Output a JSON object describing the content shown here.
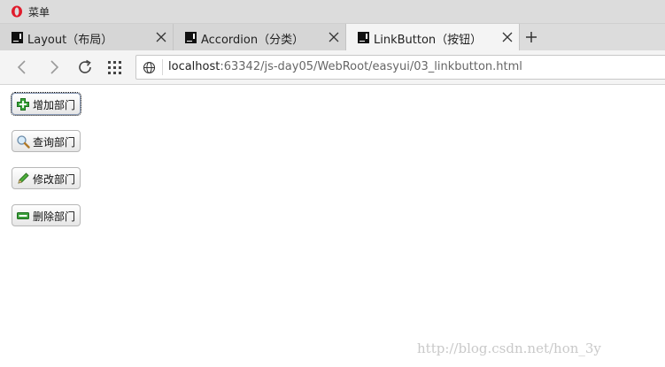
{
  "window": {
    "menu_label": "菜单"
  },
  "tabs": [
    {
      "title": "Layout（布局）",
      "active": false
    },
    {
      "title": "Accordion（分类）",
      "active": false
    },
    {
      "title": "LinkButton（按钮）",
      "active": true
    }
  ],
  "address": {
    "host": "localhost",
    "rest": ":63342/js-day05/WebRoot/easyui/03_linkbutton.html"
  },
  "buttons": [
    {
      "label": "增加部门",
      "icon": "add-icon"
    },
    {
      "label": "查询部门",
      "icon": "search-icon"
    },
    {
      "label": "修改部门",
      "icon": "edit-icon"
    },
    {
      "label": "删除部门",
      "icon": "remove-icon"
    }
  ],
  "watermark": "http://blog.csdn.net/hon_3y",
  "colors": {
    "add_green": "#2e9b2e",
    "remove_green": "#2f8f2f",
    "tab_active": "#f4f4f4"
  }
}
